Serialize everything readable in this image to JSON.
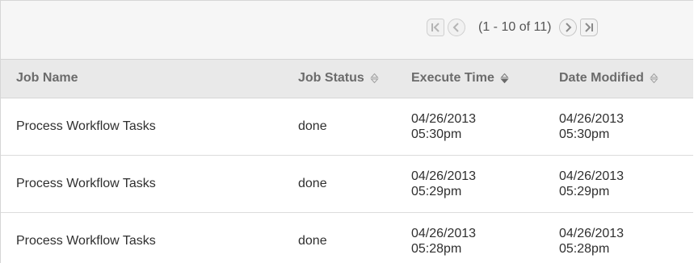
{
  "pager": {
    "info": "(1 - 10 of 11)",
    "first_icon": "first-page-icon",
    "prev_icon": "previous-page-icon",
    "next_icon": "next-page-icon",
    "last_icon": "last-page-icon"
  },
  "table": {
    "columns": [
      {
        "label": "Job Name",
        "sortable": false
      },
      {
        "label": "Job Status",
        "sortable": true
      },
      {
        "label": "Execute Time",
        "sortable": true
      },
      {
        "label": "Date Modified",
        "sortable": true
      }
    ],
    "rows": [
      {
        "job_name": "Process Workflow Tasks",
        "job_status": "done",
        "execute_date": "04/26/2013",
        "execute_time": "05:30pm",
        "modified_date": "04/26/2013",
        "modified_time": "05:30pm"
      },
      {
        "job_name": "Process Workflow Tasks",
        "job_status": "done",
        "execute_date": "04/26/2013",
        "execute_time": "05:29pm",
        "modified_date": "04/26/2013",
        "modified_time": "05:29pm"
      },
      {
        "job_name": "Process Workflow Tasks",
        "job_status": "done",
        "execute_date": "04/26/2013",
        "execute_time": "05:28pm",
        "modified_date": "04/26/2013",
        "modified_time": "05:28pm"
      }
    ]
  },
  "colors": {
    "header_bg": "#e9e9e9",
    "pager_bg": "#f6f6f6",
    "row_divider": "#dcdcdc"
  }
}
